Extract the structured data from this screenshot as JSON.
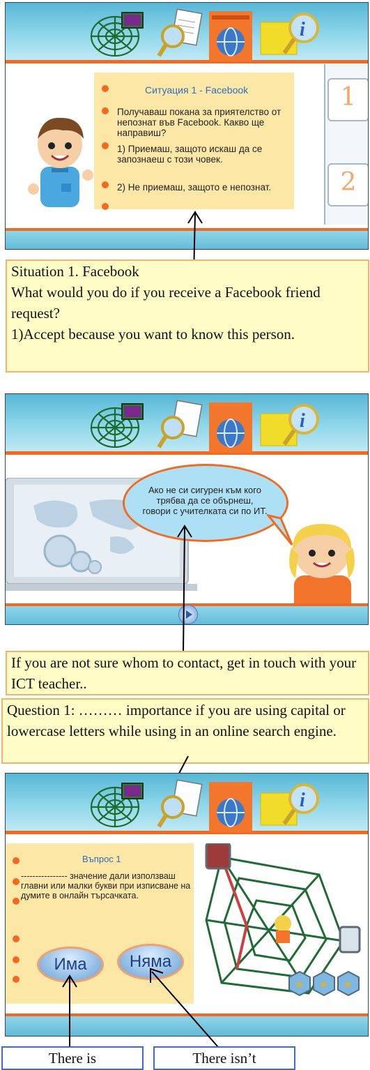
{
  "panel1": {
    "title": "Ситуация 1 - Facebook",
    "question": "Получаваш покана  за приятелство от непознат във Facebook. Какво ще направиш?",
    "option1": "1) Приемаш, защото искаш да се запознаеш с този човек.",
    "option2": "2) Не приемаш, защото е непознат.",
    "side_number_1": "1",
    "side_number_2": "2"
  },
  "caption1": {
    "line1": "Situation 1.  Facebook",
    "line2": "What would you do if you receive a Facebook friend request?",
    "line3": "1)Accept because you want to know this person."
  },
  "panel2": {
    "bubble_text": "Ако не си сигурен към кого трябва да се обърнеш, говори с учителката си по ИТ."
  },
  "caption2": {
    "text": "If you are not sure whom to contact, get in touch with your ICT teacher.."
  },
  "caption3": {
    "text": "Question 1: ……… importance if you are using capital or lowercase letters while using in an online search engine."
  },
  "panel3": {
    "title": "Въпрос 1",
    "question": "---------------- значение дали използваш главни или малки букви при изписване на думите в онлайн търсачката.",
    "answer_yes": "Има",
    "answer_no": "Няма"
  },
  "answers": {
    "yes_en": "There is",
    "no_en": "There isn’t"
  },
  "colors": {
    "accent_orange": "#f26a22",
    "sky_blue": "#57b7d6",
    "card_yellow": "#fde7a6",
    "caption_bg": "#fffcc6"
  }
}
